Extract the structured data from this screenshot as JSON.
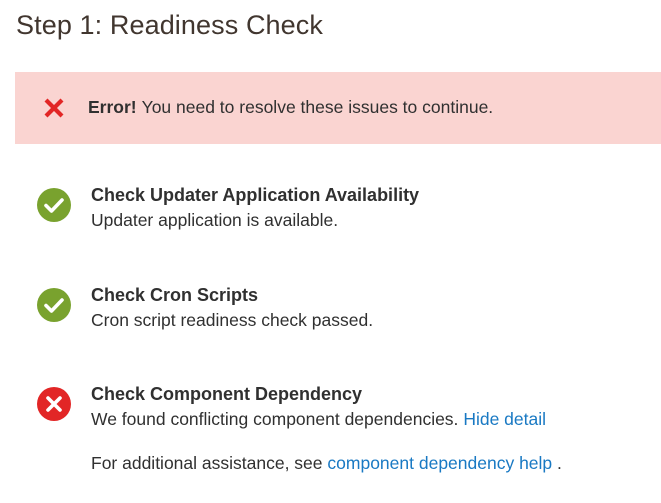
{
  "page": {
    "title": "Step 1: Readiness Check"
  },
  "error_banner": {
    "label": "Error!",
    "message": "You need to resolve these issues to continue."
  },
  "checks": [
    {
      "title": "Check Updater Application Availability",
      "description": "Updater application is available.",
      "status": "success",
      "icon": "check-circle-icon"
    },
    {
      "title": "Check Cron Scripts",
      "description": "Cron script readiness check passed.",
      "status": "success",
      "icon": "check-circle-icon"
    },
    {
      "title": "Check Component Dependency",
      "description": "We found conflicting component dependencies.",
      "toggle_link": "Hide detail",
      "assistance_prefix": "For additional assistance, see",
      "assistance_link": "component dependency help",
      "assistance_suffix": ".",
      "status": "error",
      "icon": "error-circle-icon"
    }
  ],
  "colors": {
    "success": "#79a22e",
    "error": "#e22626",
    "error_banner_bg": "#fad4d1",
    "link": "#1979c3",
    "text": "#303030"
  }
}
